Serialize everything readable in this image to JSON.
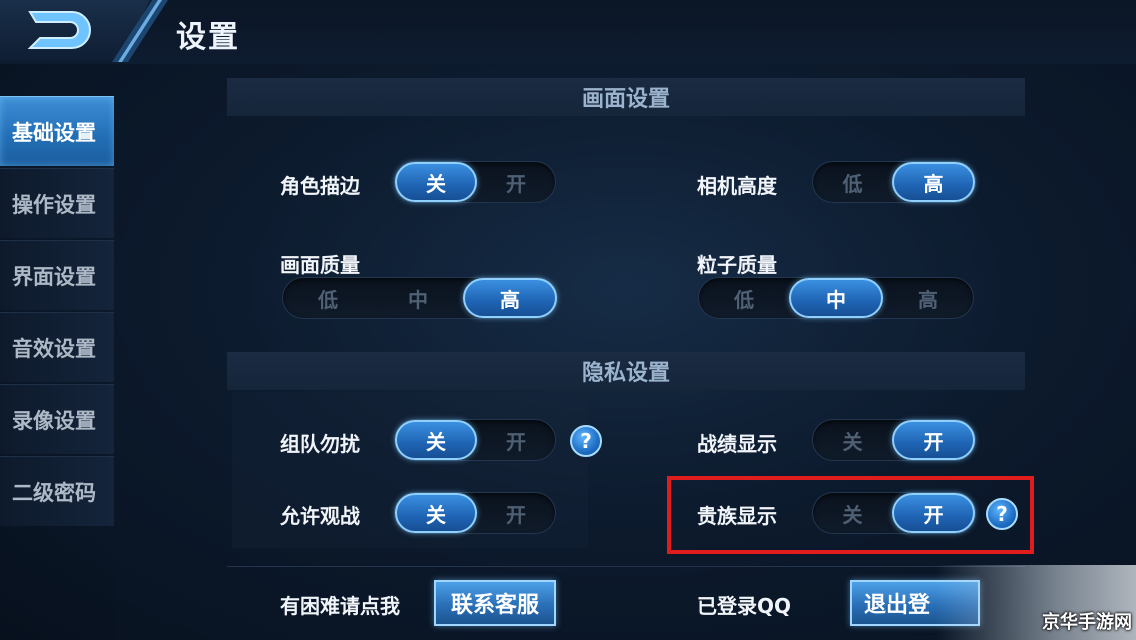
{
  "header": {
    "title": "设置",
    "back_icon": "back-arrow-icon"
  },
  "sidebar": {
    "items": [
      {
        "label": "基础设置",
        "active": true
      },
      {
        "label": "操作设置",
        "active": false
      },
      {
        "label": "界面设置",
        "active": false
      },
      {
        "label": "音效设置",
        "active": false
      },
      {
        "label": "录像设置",
        "active": false
      },
      {
        "label": "二级密码",
        "active": false
      }
    ]
  },
  "graphics": {
    "title": "画面设置",
    "outline": {
      "label": "角色描边",
      "options": [
        "关",
        "开"
      ],
      "selected": "关"
    },
    "camera": {
      "label": "相机高度",
      "options": [
        "低",
        "高"
      ],
      "selected": "高"
    },
    "quality": {
      "label": "画面质量",
      "options": [
        "低",
        "中",
        "高"
      ],
      "selected": "高"
    },
    "particle": {
      "label": "粒子质量",
      "options": [
        "低",
        "中",
        "高"
      ],
      "selected": "中"
    }
  },
  "privacy": {
    "title": "隐私设置",
    "team_dnd": {
      "label": "组队勿扰",
      "options": [
        "关",
        "开"
      ],
      "selected": "关",
      "help": "?"
    },
    "record": {
      "label": "战绩显示",
      "options": [
        "关",
        "开"
      ],
      "selected": "开"
    },
    "spectate": {
      "label": "允许观战",
      "options": [
        "关",
        "开"
      ],
      "selected": "关"
    },
    "noble": {
      "label": "贵族显示",
      "options": [
        "关",
        "开"
      ],
      "selected": "开",
      "help": "?"
    }
  },
  "footer": {
    "help_text": "有困难请点我",
    "contact_button": "联系客服",
    "login_text": "已登录QQ",
    "logout_button": "退出登"
  },
  "watermark": "京华手游网",
  "colors": {
    "accent": "#2a74c4",
    "highlight_border": "#e01c1c"
  }
}
